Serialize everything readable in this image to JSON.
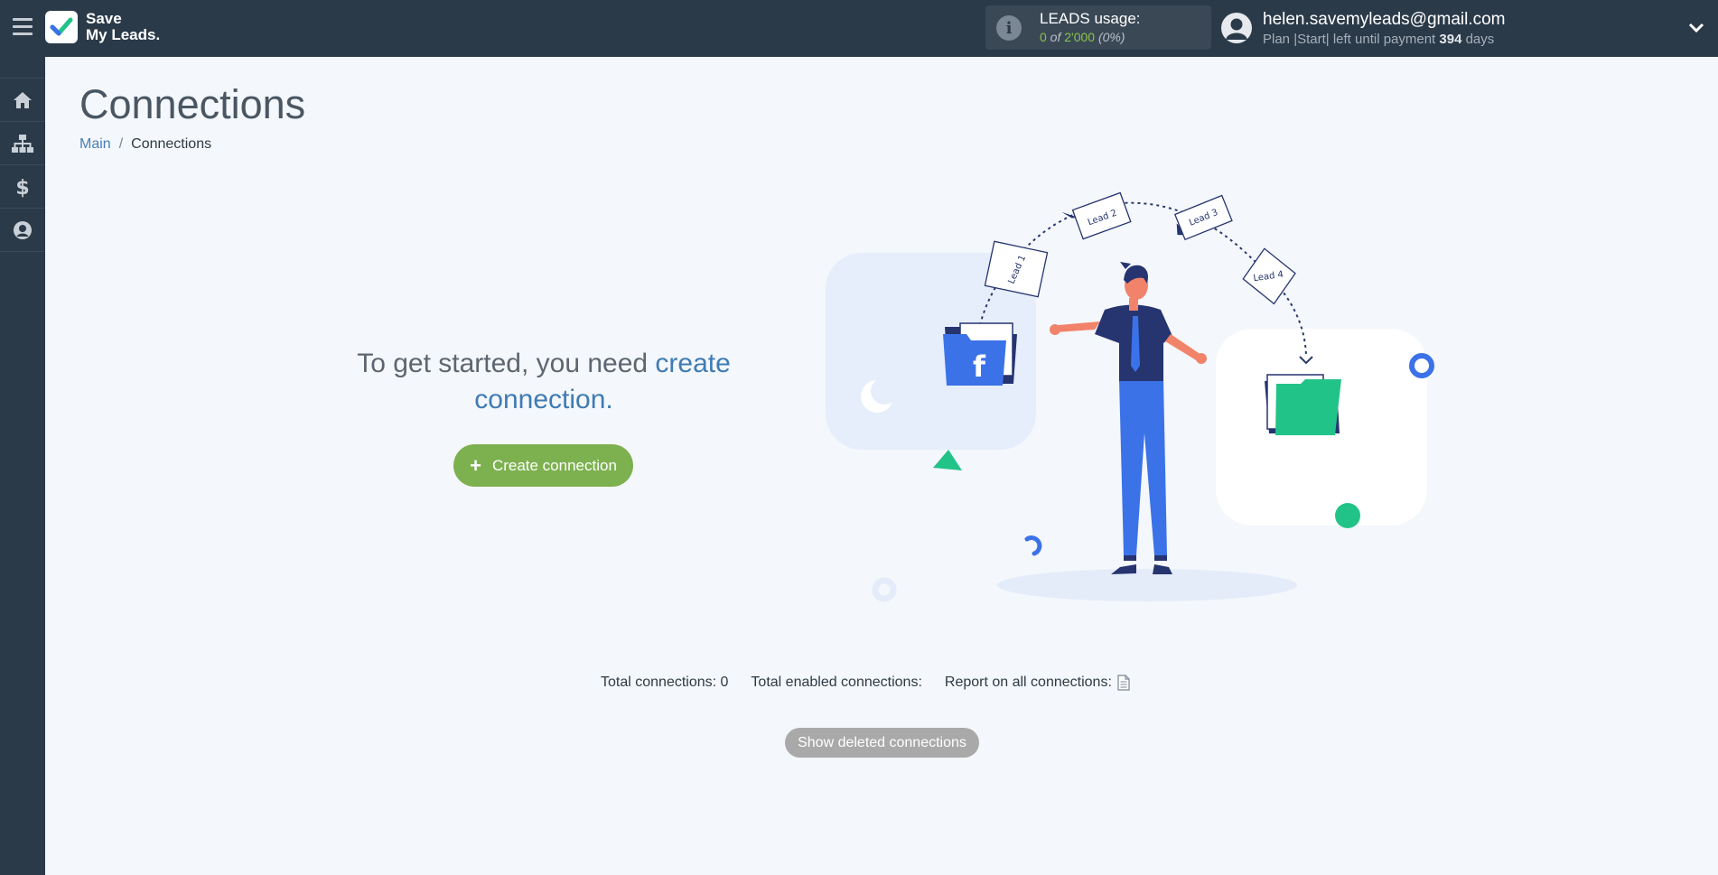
{
  "header": {
    "logo_line1": "Save",
    "logo_line2": "My Leads.",
    "usage_title": "LEADS usage:",
    "usage_used": "0",
    "usage_of": " of ",
    "usage_total": "2'000",
    "usage_percent": "(0%)",
    "user_email": "helen.savemyleads@gmail.com",
    "plan_text": "Plan |Start| left until payment ",
    "plan_days": "394",
    "plan_days_suffix": " days"
  },
  "sidebar": {
    "items": [
      {
        "icon": "home-icon"
      },
      {
        "icon": "sitemap-icon"
      },
      {
        "icon": "dollar-icon"
      },
      {
        "icon": "user-circle-icon"
      }
    ]
  },
  "page": {
    "title": "Connections",
    "breadcrumb": {
      "main": "Main",
      "separator": "/",
      "current": "Connections"
    }
  },
  "empty_state": {
    "text_before": "To get started, you need ",
    "link_text": "create connection",
    "text_after": ".",
    "create_button": "Create connection"
  },
  "illustration": {
    "leads": [
      "Lead 1",
      "Lead 2",
      "Lead 3",
      "Lead 4"
    ],
    "source_letter": "f"
  },
  "stats": {
    "total": "Total connections: 0",
    "enabled": "Total enabled connections:",
    "report": "Report on all connections:"
  },
  "show_deleted_button": "Show deleted connections",
  "colors": {
    "topbar": "#2b3a49",
    "accent_green": "#7db14f",
    "link_blue": "#3f7bb3",
    "folder_blue": "#3b72e8",
    "folder_green": "#22c388"
  }
}
